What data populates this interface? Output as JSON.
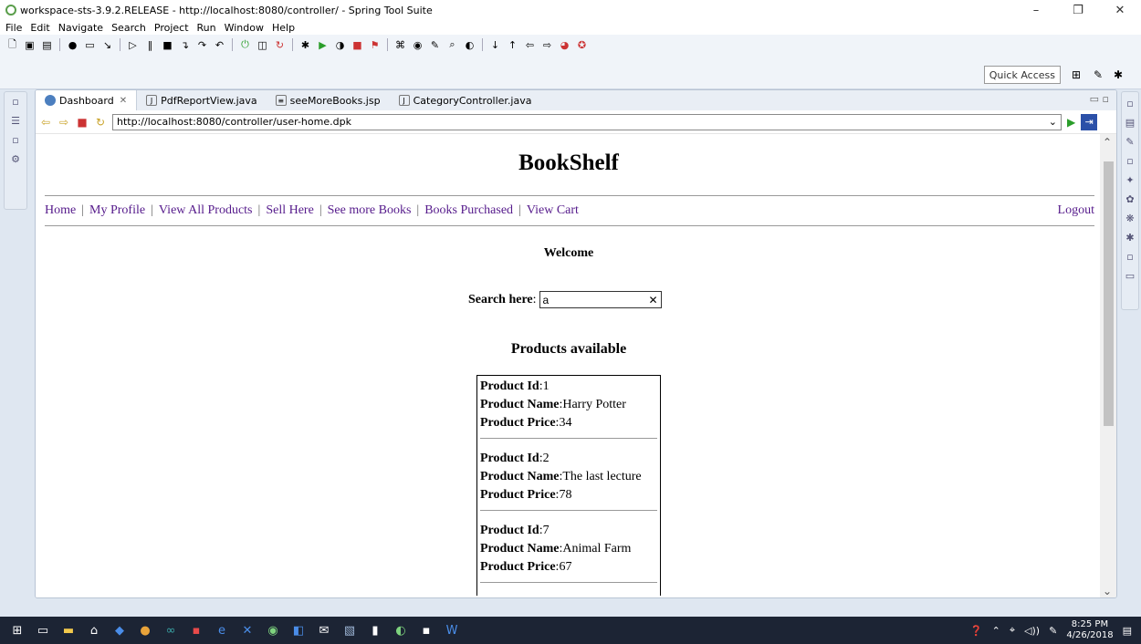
{
  "window": {
    "title": "workspace-sts-3.9.2.RELEASE - http://localhost:8080/controller/ - Spring Tool Suite"
  },
  "menu": [
    "File",
    "Edit",
    "Navigate",
    "Search",
    "Project",
    "Run",
    "Window",
    "Help"
  ],
  "quick_access": "Quick Access",
  "tabs": [
    {
      "label": "Dashboard",
      "icon": "globe-icon",
      "active": true
    },
    {
      "label": "PdfReportView.java",
      "icon": "java-file-icon"
    },
    {
      "label": "seeMoreBooks.jsp",
      "icon": "jsp-file-icon"
    },
    {
      "label": "CategoryController.java",
      "icon": "java-file-icon"
    }
  ],
  "browser": {
    "url": "http://localhost:8080/controller/user-home.dpk"
  },
  "page": {
    "title": "BookShelf",
    "nav": [
      "Home",
      "My Profile",
      "View All Products",
      "Sell Here",
      "See more Books",
      "Books Purchased",
      "View Cart"
    ],
    "logout": "Logout",
    "welcome": "Welcome",
    "search_label": "Search here",
    "search_value": "a",
    "products_heading": "Products available",
    "product_labels": {
      "id": "Product Id",
      "name": "Product Name",
      "price": "Product Price"
    },
    "products": [
      {
        "id": "1",
        "name": "Harry Potter",
        "price": "34"
      },
      {
        "id": "2",
        "name": "The last lecture",
        "price": "78"
      },
      {
        "id": "7",
        "name": "Animal Farm",
        "price": "67"
      }
    ]
  },
  "taskbar": {
    "time": "8:25 PM",
    "date": "4/26/2018"
  },
  "colors": {
    "link": "#551a8b",
    "taskbar": "#1c2434",
    "ide_bg": "#dfe7f1"
  }
}
